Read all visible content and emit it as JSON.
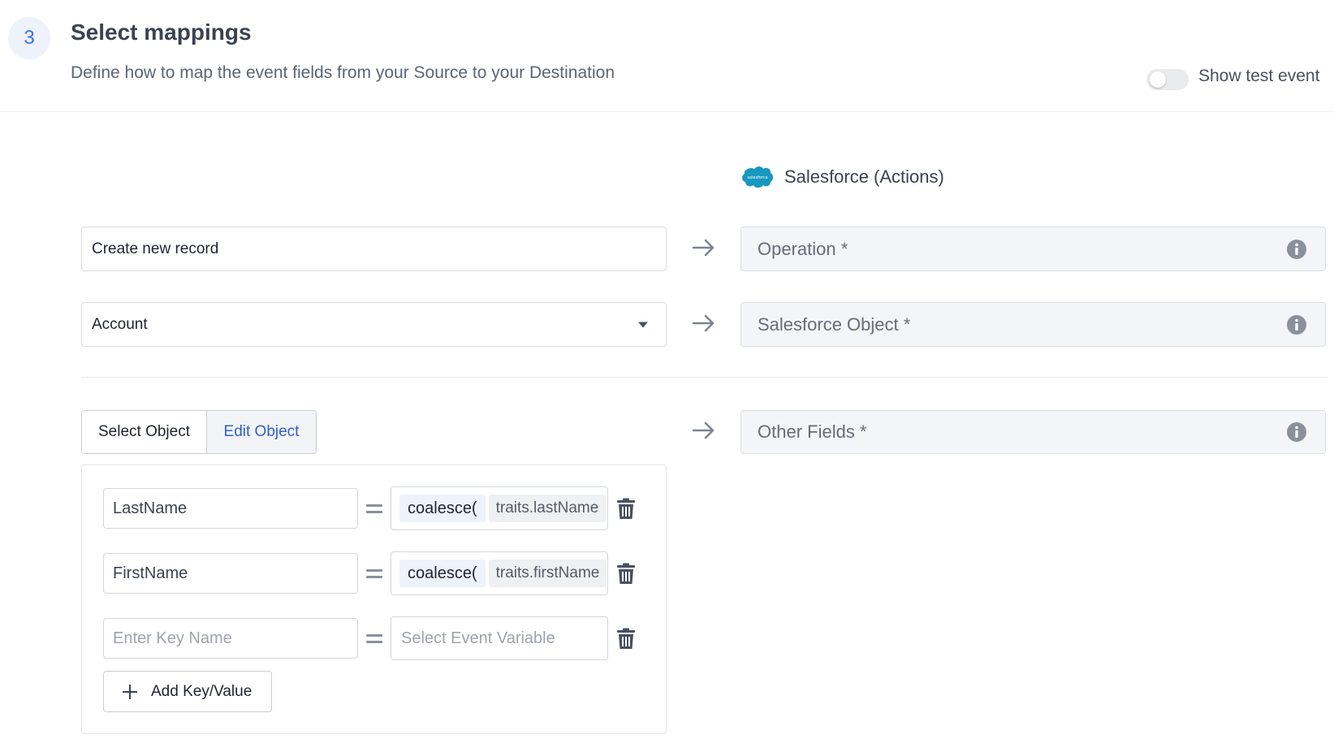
{
  "step": {
    "number": "3",
    "title": "Select mappings",
    "subtitle": "Define how to map the event fields from your Source to your Destination"
  },
  "toggle": {
    "label": "Show test event",
    "on": false
  },
  "destination": {
    "name": "Salesforce (Actions)",
    "logo_text": "salesforce",
    "logo_color": "#1798c1"
  },
  "mappings": [
    {
      "source_value": "Create new record",
      "target_label": "Operation *"
    },
    {
      "source_value": "Account",
      "target_label": "Salesforce Object *"
    }
  ],
  "object_editor": {
    "tabs": {
      "select": "Select Object",
      "edit": "Edit Object",
      "active": "edit"
    },
    "target_label": "Other Fields *",
    "rows": [
      {
        "key": "LastName",
        "fn": "coalesce(",
        "var": "traits.lastName"
      },
      {
        "key": "FirstName",
        "fn": "coalesce(",
        "var": "traits.firstName"
      }
    ],
    "empty_row": {
      "key_placeholder": "Enter Key Name",
      "value_placeholder": "Select Event Variable"
    },
    "add_label": "Add Key/Value"
  },
  "colors": {
    "accent": "#3b6fe0",
    "link": "#2f5fc9",
    "badge_bg": "#eef2fb",
    "field_bg": "#f4f5f8"
  }
}
